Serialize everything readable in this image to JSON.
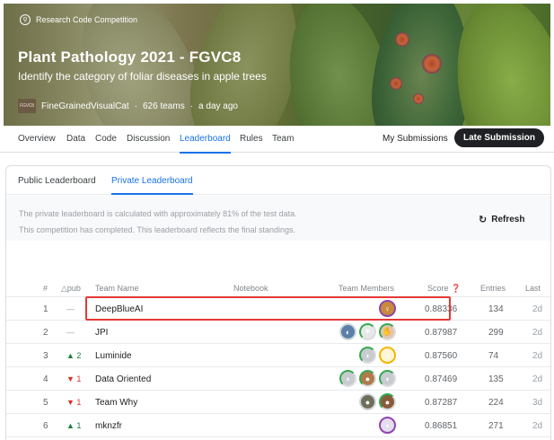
{
  "competition": {
    "type_label": "Research Code Competition",
    "title": "Plant Pathology 2021 - FGVC8",
    "subtitle": "Identify the category of foliar diseases in apple trees",
    "host_logo_text": "FGVC8",
    "host": "FineGrainedVisualCat",
    "teams": "626 teams",
    "updated": "a day ago"
  },
  "nav": {
    "tabs": [
      "Overview",
      "Data",
      "Code",
      "Discussion",
      "Leaderboard",
      "Rules",
      "Team"
    ],
    "active_tab": "Leaderboard",
    "my_submissions": "My Submissions",
    "late_submission": "Late Submission"
  },
  "leaderboard": {
    "subtabs": [
      "Public Leaderboard",
      "Private Leaderboard"
    ],
    "active_subtab": "Private Leaderboard",
    "info_line1": "The private leaderboard is calculated with approximately 81% of the test data.",
    "info_line2": "This competition has completed. This leaderboard reflects the final standings.",
    "refresh_label": "Refresh",
    "columns": [
      "#",
      "△pub",
      "Team Name",
      "Notebook",
      "Team Members",
      "Score ❓",
      "Entries",
      "Last"
    ],
    "rows": [
      {
        "rank": "1",
        "delta": "—",
        "delta_dir": "same",
        "team": "DeepBlueAI",
        "score": "0.88336",
        "entries": "134",
        "last": "2d",
        "members": [
          "avatar-woman"
        ]
      },
      {
        "rank": "2",
        "delta": "—",
        "delta_dir": "same",
        "team": "JPI",
        "score": "0.87987",
        "entries": "299",
        "last": "2d",
        "members": [
          "avatar-blue",
          "avatar-tree",
          "avatar-hands"
        ]
      },
      {
        "rank": "3",
        "delta": "▲ 2",
        "delta_dir": "up",
        "team": "Luminide",
        "score": "0.87560",
        "entries": "74",
        "last": "2d",
        "members": [
          "avatar-grey",
          "avatar-gold"
        ]
      },
      {
        "rank": "4",
        "delta": "▼ 1",
        "delta_dir": "down",
        "team": "Data Oriented",
        "score": "0.87469",
        "entries": "135",
        "last": "2d",
        "members": [
          "avatar-grey",
          "avatar-person",
          "avatar-grey"
        ]
      },
      {
        "rank": "5",
        "delta": "▼ 1",
        "delta_dir": "down",
        "team": "Team Why",
        "score": "0.87287",
        "entries": "224",
        "last": "3d",
        "members": [
          "avatar-dark",
          "avatar-person2"
        ]
      },
      {
        "rank": "6",
        "delta": "▲ 1",
        "delta_dir": "up",
        "team": "mknzfr",
        "score": "0.86851",
        "entries": "271",
        "last": "2d",
        "members": [
          "avatar-purple"
        ]
      }
    ]
  },
  "colors": {
    "accent": "#1a73e8",
    "up": "#188038",
    "down": "#d93025",
    "highlight": "#e53935"
  }
}
